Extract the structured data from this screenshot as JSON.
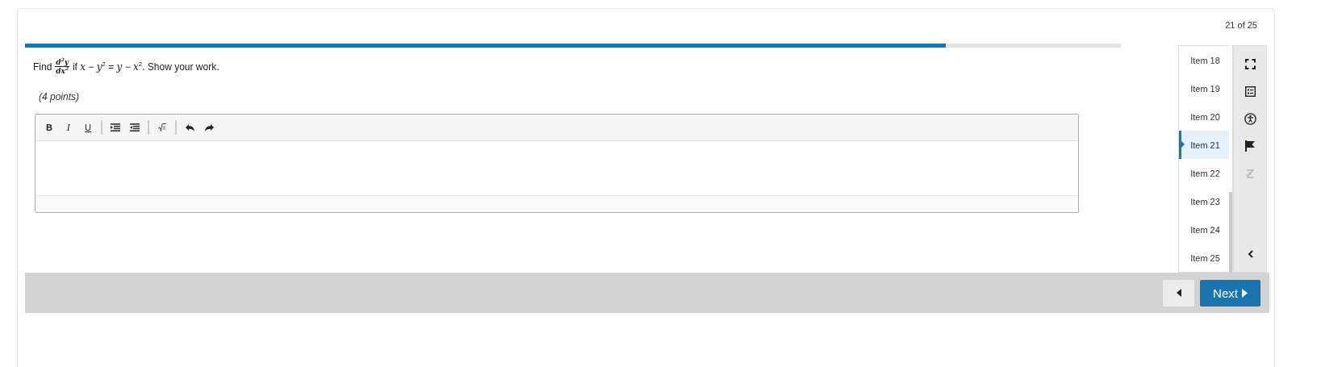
{
  "counter": "21 of 25",
  "progress": {
    "level": 0.84
  },
  "question": {
    "prefix": "Find",
    "frac_num": "d$^{2}$y",
    "frac_den": "dx$^{2}$",
    "rest": "if *x* − *y*$^{2}$ = *y* − *x*$^{2}$. Show your work.",
    "points": "(4 points)"
  },
  "toolbar": [
    {
      "kind": "bold",
      "label": "B"
    },
    {
      "kind": "italic",
      "label": "I"
    },
    {
      "kind": "underline",
      "label": "U"
    },
    {
      "kind": "separator"
    },
    {
      "kind": "outdent"
    },
    {
      "kind": "indent"
    },
    {
      "kind": "separator"
    },
    {
      "kind": "sqrt"
    },
    {
      "kind": "separator"
    },
    {
      "kind": "undo"
    },
    {
      "kind": "redo"
    }
  ],
  "items": [
    {
      "label": "Item 18",
      "selected": false
    },
    {
      "label": "Item 19",
      "selected": false
    },
    {
      "label": "Item 20",
      "selected": false
    },
    {
      "label": "Item 21",
      "selected": true
    },
    {
      "label": "Item 22",
      "selected": false
    },
    {
      "label": "Item 23",
      "selected": false
    },
    {
      "label": "Item 24",
      "selected": false
    },
    {
      "label": "Item 25",
      "selected": false
    }
  ],
  "tools": [
    {
      "kind": "fullscreen",
      "disabled": false
    },
    {
      "kind": "list",
      "disabled": false
    },
    {
      "kind": "accessibility",
      "disabled": false
    },
    {
      "kind": "flag",
      "disabled": false
    },
    {
      "kind": "strike",
      "disabled": true
    }
  ],
  "nav": {
    "next": "Next"
  }
}
